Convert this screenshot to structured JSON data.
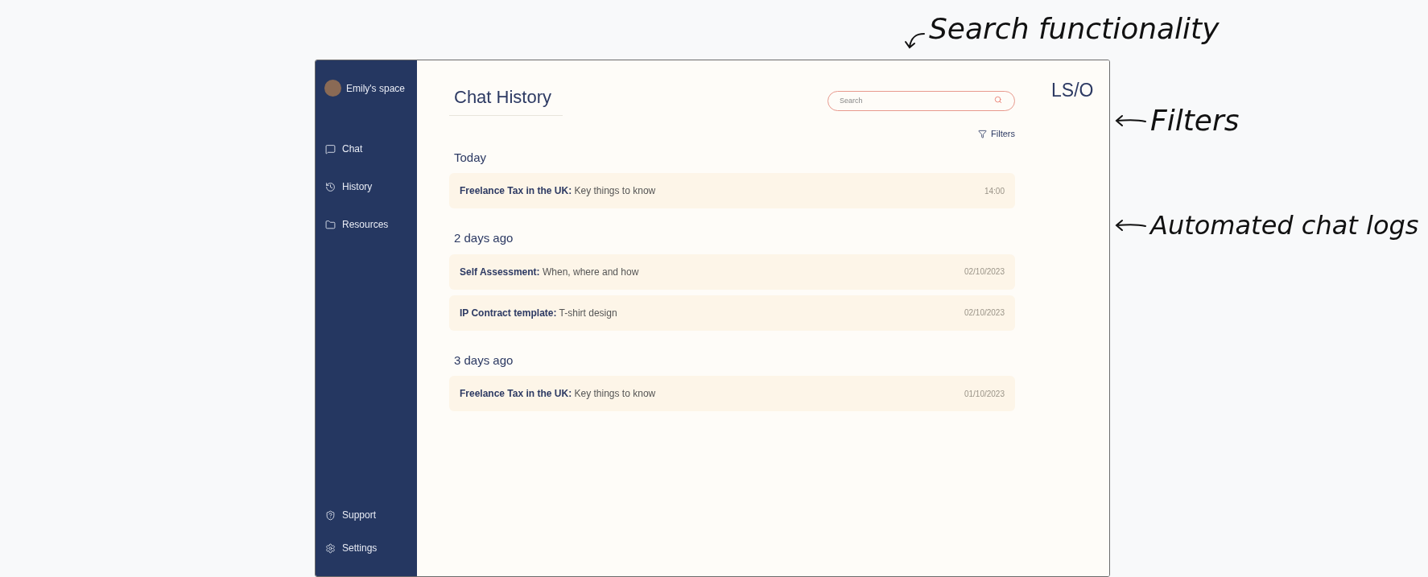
{
  "annotations": {
    "search": "Search functionality",
    "filters": "Filters",
    "chat_logs": "Automated chat logs"
  },
  "sidebar": {
    "user": "Emily's space",
    "items": [
      {
        "label": "Chat",
        "kind": "chat"
      },
      {
        "label": "History",
        "kind": "history"
      },
      {
        "label": "Resources",
        "kind": "folder"
      }
    ],
    "bottom_items": [
      {
        "label": "Support",
        "kind": "support"
      },
      {
        "label": "Settings",
        "kind": "settings"
      }
    ]
  },
  "main": {
    "title": "Chat History",
    "search": {
      "placeholder": "Search"
    },
    "logo": "LS/O",
    "filters": "Filters",
    "groups": [
      {
        "label": "Today",
        "chats": [
          {
            "title": "Freelance Tax in the UK:",
            "subtitle": "Key things to know",
            "time": "14:00"
          }
        ]
      },
      {
        "label": "2 days ago",
        "chats": [
          {
            "title": "Self Assessment:",
            "subtitle": "When, where and how",
            "time": "02/10/2023"
          },
          {
            "title": "IP Contract template:",
            "subtitle": "T-shirt design",
            "time": "02/10/2023"
          }
        ]
      },
      {
        "label": "3 days ago",
        "chats": [
          {
            "title": "Freelance Tax in the UK:",
            "subtitle": "Key things to know",
            "time": "01/10/2023"
          }
        ]
      }
    ]
  }
}
